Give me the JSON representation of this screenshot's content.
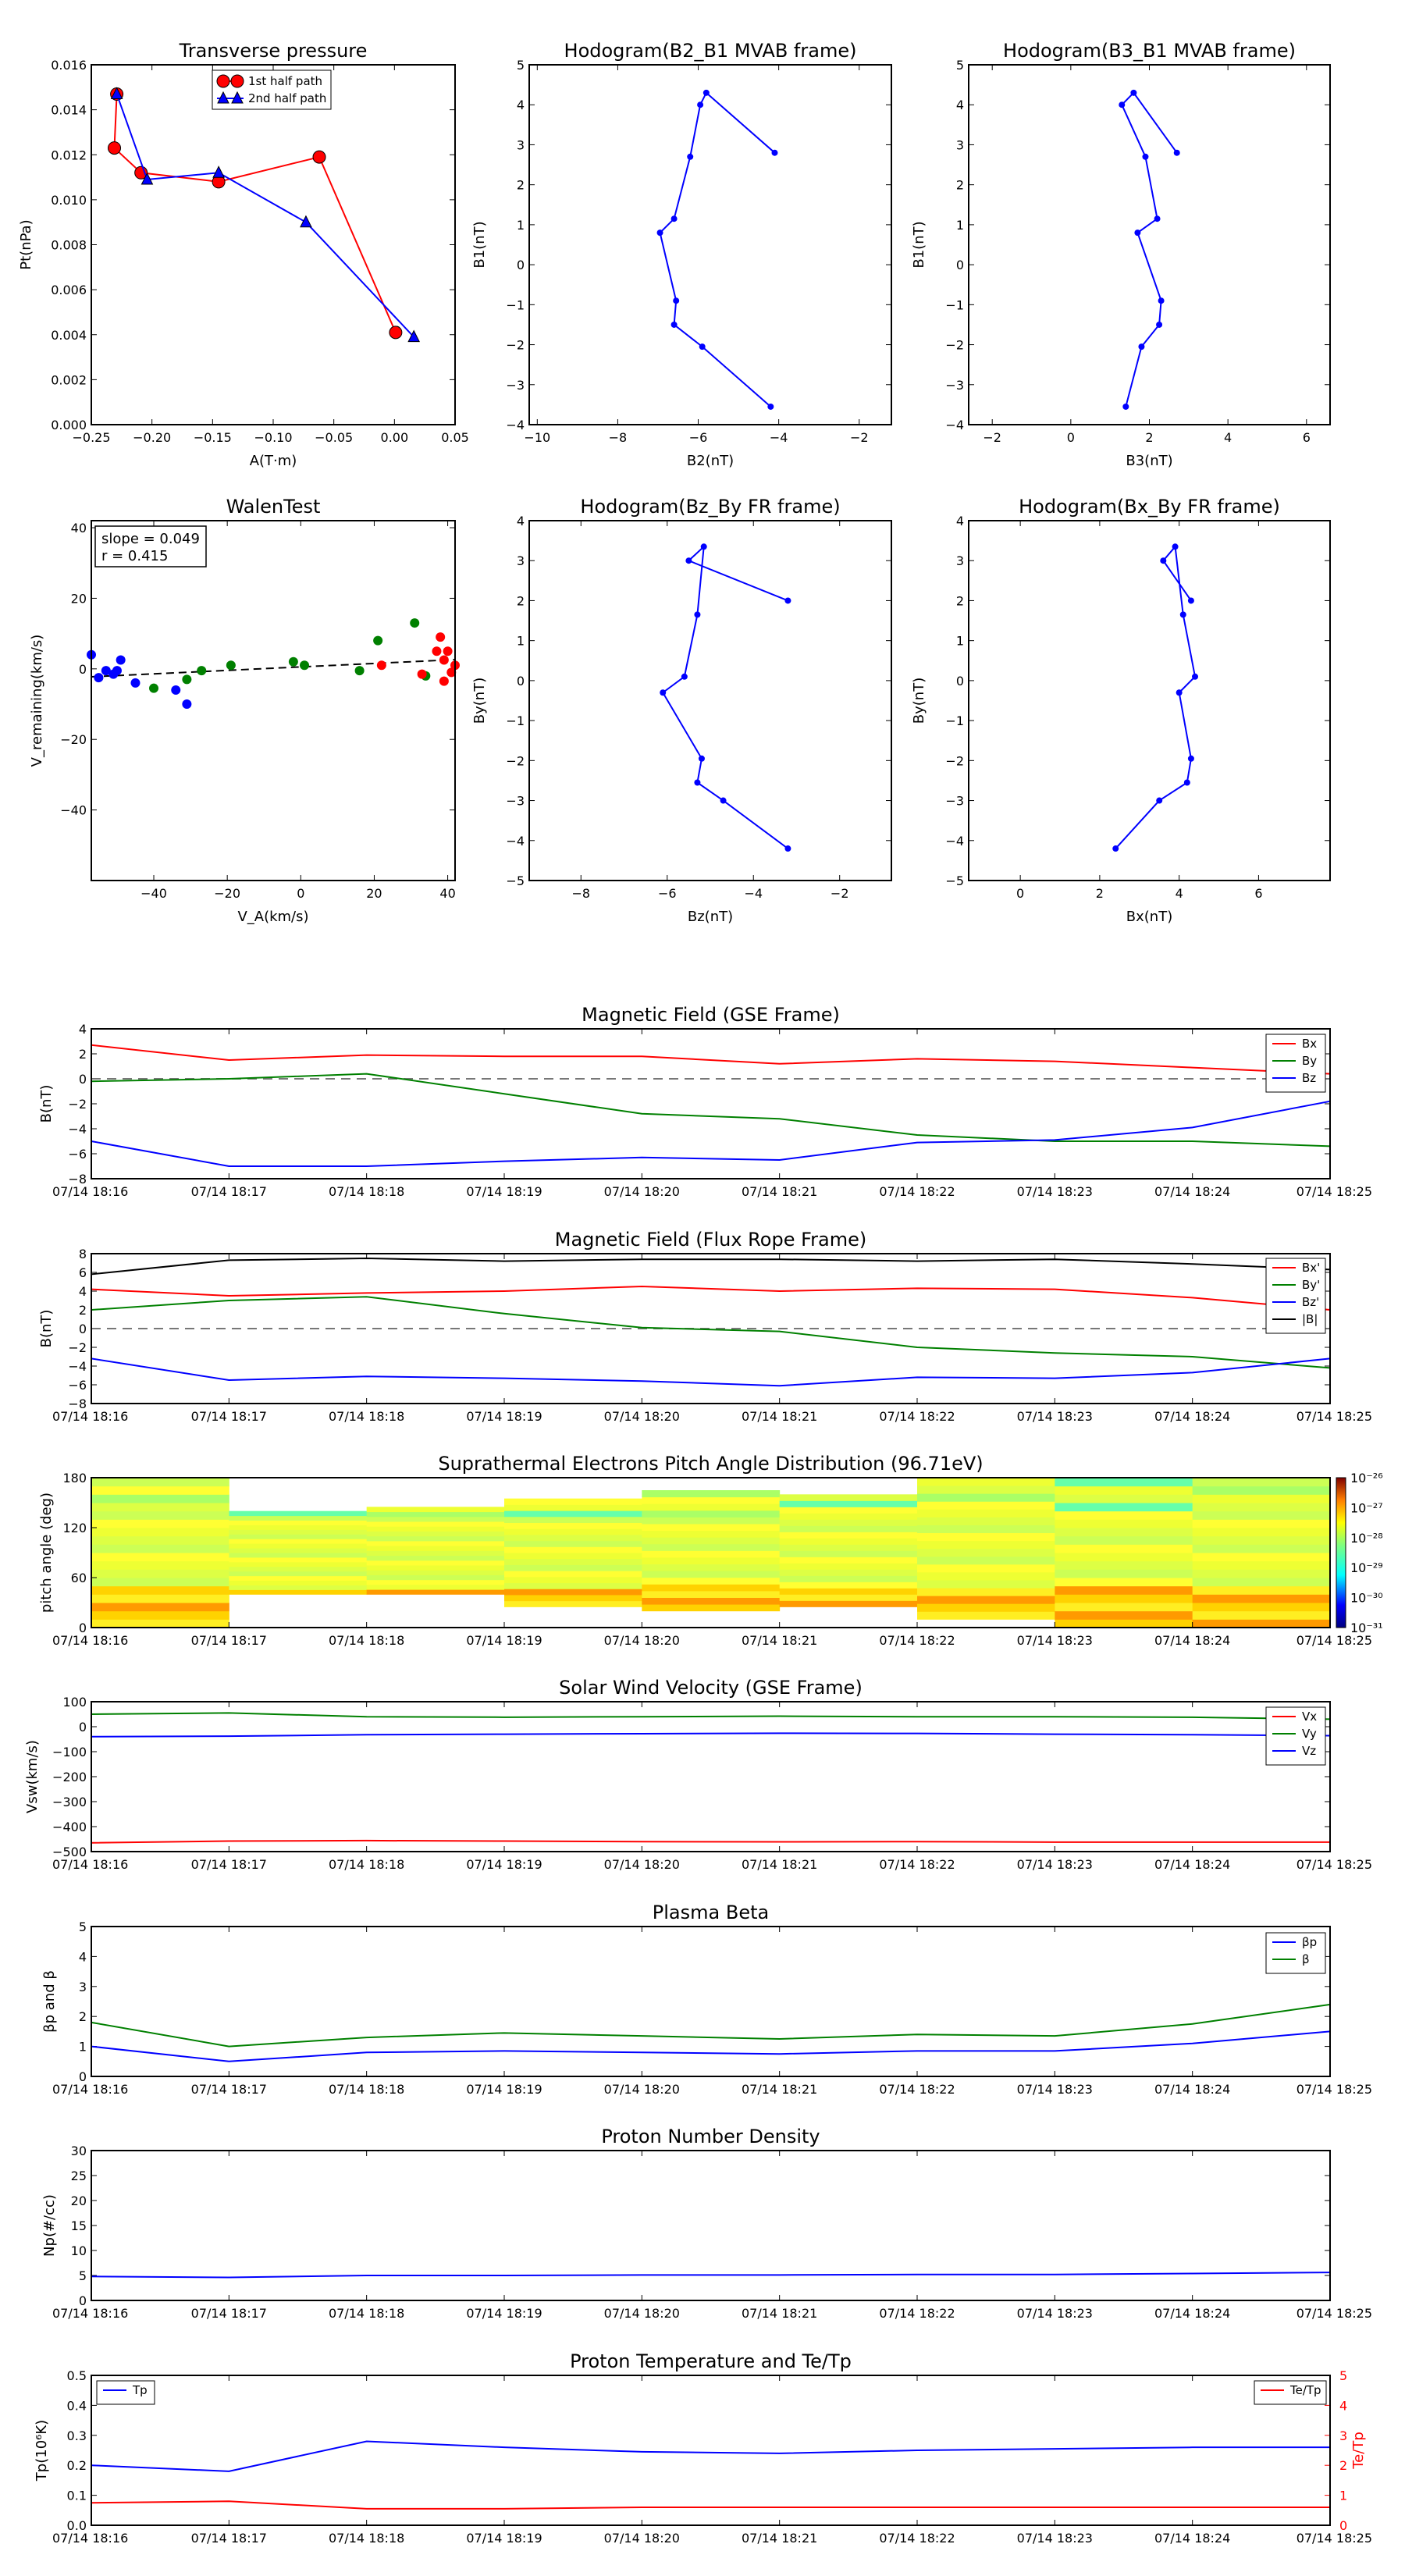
{
  "times": [
    "07/14 18:16",
    "07/14 18:17",
    "07/14 18:18",
    "07/14 18:19",
    "07/14 18:20",
    "07/14 18:21",
    "07/14 18:22",
    "07/14 18:23",
    "07/14 18:24",
    "07/14 18:25"
  ],
  "chart_data": [
    {
      "id": "transverse-pressure",
      "type": "line",
      "title": "Transverse pressure",
      "xlabel": "A(T·m)",
      "ylabel": "Pt(nPa)",
      "xlim": [
        -0.25,
        0.05
      ],
      "ylim": [
        0,
        0.016
      ],
      "xticks": [
        -0.25,
        -0.2,
        -0.15,
        -0.1,
        -0.05,
        0.0,
        0.05
      ],
      "xticklabels": [
        "−0.25",
        "−0.20",
        "−0.15",
        "−0.10",
        "−0.05",
        "0.00",
        "0.05"
      ],
      "yticks": [
        0,
        0.002,
        0.004,
        0.006,
        0.008,
        0.01,
        0.012,
        0.014,
        0.016
      ],
      "yticklabels": [
        "0.000",
        "0.002",
        "0.004",
        "0.006",
        "0.008",
        "0.010",
        "0.012",
        "0.014",
        "0.016"
      ],
      "legend_position": "top-center",
      "series": [
        {
          "name": "1st half path",
          "color": "#ff0000",
          "marker": "circle",
          "x": [
            -0.229,
            -0.231,
            -0.209,
            -0.145,
            -0.062,
            0.001
          ],
          "y": [
            0.0147,
            0.0123,
            0.0112,
            0.0108,
            0.0119,
            0.0041
          ]
        },
        {
          "name": "2nd half path",
          "color": "#0000ff",
          "marker": "triangle",
          "x": [
            -0.229,
            -0.204,
            -0.145,
            -0.073,
            0.016
          ],
          "y": [
            0.0147,
            0.0109,
            0.0112,
            0.009,
            0.0039
          ]
        }
      ]
    },
    {
      "id": "hodogram-b2-b1",
      "type": "line",
      "title": "Hodogram(B2_B1 MVAB frame)",
      "xlabel": "B2(nT)",
      "ylabel": "B1(nT)",
      "xlim": [
        -10.2,
        -1.2
      ],
      "ylim": [
        -4,
        5
      ],
      "xticks": [
        -10,
        -8,
        -6,
        -4,
        -2
      ],
      "xticklabels": [
        "−10",
        "−8",
        "−6",
        "−4",
        "−2"
      ],
      "yticks": [
        -4,
        -3,
        -2,
        -1,
        0,
        1,
        2,
        3,
        4,
        5
      ],
      "yticklabels": [
        "−4",
        "−3",
        "−2",
        "−1",
        "0",
        "1",
        "2",
        "3",
        "4",
        "5"
      ],
      "series": [
        {
          "color": "#0000ff",
          "x": [
            -4.1,
            -5.8,
            -5.95,
            -6.2,
            -6.6,
            -6.95,
            -6.55,
            -6.6,
            -5.9,
            -4.2
          ],
          "y": [
            2.8,
            4.3,
            4.0,
            2.7,
            1.15,
            0.8,
            -0.9,
            -1.5,
            -2.05,
            -3.55
          ]
        }
      ]
    },
    {
      "id": "hodogram-b3-b1",
      "type": "line",
      "title": "Hodogram(B3_B1 MVAB frame)",
      "xlabel": "B3(nT)",
      "ylabel": "B1(nT)",
      "xlim": [
        -2.6,
        6.6
      ],
      "ylim": [
        -4,
        5
      ],
      "xticks": [
        -2,
        0,
        2,
        4,
        6
      ],
      "xticklabels": [
        "−2",
        "0",
        "2",
        "4",
        "6"
      ],
      "yticks": [
        -4,
        -3,
        -2,
        -1,
        0,
        1,
        2,
        3,
        4,
        5
      ],
      "yticklabels": [
        "−4",
        "−3",
        "−2",
        "−1",
        "0",
        "1",
        "2",
        "3",
        "4",
        "5"
      ],
      "series": [
        {
          "color": "#0000ff",
          "x": [
            2.7,
            1.6,
            1.3,
            1.9,
            2.2,
            1.7,
            2.3,
            2.25,
            1.8,
            1.4
          ],
          "y": [
            2.8,
            4.3,
            4.0,
            2.7,
            1.15,
            0.8,
            -0.9,
            -1.5,
            -2.05,
            -3.55
          ]
        }
      ]
    },
    {
      "id": "walen-test",
      "type": "scatter",
      "title": "WalenTest",
      "xlabel": "V_A(km/s)",
      "ylabel": "V_remaining(km/s)",
      "annotation": [
        "slope = 0.049",
        "r = 0.415"
      ],
      "xlim": [
        -57,
        42
      ],
      "ylim": [
        -60,
        42
      ],
      "xticks": [
        -40,
        -20,
        0,
        20,
        40
      ],
      "xticklabels": [
        "−40",
        "−20",
        "0",
        "20",
        "40"
      ],
      "yticks": [
        -40,
        -20,
        0,
        20,
        40
      ],
      "yticklabels": [
        "−40",
        "−20",
        "0",
        "20",
        "40"
      ],
      "fit": {
        "slope": 0.049,
        "intercept": 0.55
      },
      "series": [
        {
          "color": "#0000ff",
          "x": [
            -57,
            -55,
            -53,
            -51,
            -50,
            -49,
            -45,
            -34,
            -31
          ],
          "y": [
            4,
            -2.5,
            -0.5,
            -1.5,
            -0.5,
            2.5,
            -4,
            -6,
            -10
          ]
        },
        {
          "color": "#008000",
          "x": [
            -40,
            -31,
            -27,
            -19,
            -2,
            1,
            16,
            21,
            31,
            34
          ],
          "y": [
            -5.5,
            -3,
            -0.5,
            1,
            2,
            1,
            -0.5,
            8,
            13,
            -2
          ]
        },
        {
          "color": "#ff0000",
          "x": [
            22,
            33,
            37,
            38,
            39,
            39,
            40,
            41,
            42
          ],
          "y": [
            1,
            -1.5,
            5,
            9,
            2.5,
            -3.5,
            5,
            -1,
            1
          ]
        }
      ]
    },
    {
      "id": "hodogram-bz-by",
      "type": "line",
      "title": "Hodogram(Bz_By FR frame)",
      "xlabel": "Bz(nT)",
      "ylabel": "By(nT)",
      "xlim": [
        -9.2,
        -0.8
      ],
      "ylim": [
        -5,
        4
      ],
      "xticks": [
        -8,
        -6,
        -4,
        -2
      ],
      "xticklabels": [
        "−8",
        "−6",
        "−4",
        "−2"
      ],
      "yticks": [
        -5,
        -4,
        -3,
        -2,
        -1,
        0,
        1,
        2,
        3,
        4
      ],
      "yticklabels": [
        "−5",
        "−4",
        "−3",
        "−2",
        "−1",
        "0",
        "1",
        "2",
        "3",
        "4"
      ],
      "series": [
        {
          "color": "#0000ff",
          "x": [
            -3.2,
            -5.5,
            -5.15,
            -5.3,
            -5.6,
            -6.1,
            -5.2,
            -5.3,
            -4.7,
            -3.2
          ],
          "y": [
            2.0,
            3.0,
            3.35,
            1.65,
            0.1,
            -0.3,
            -1.95,
            -2.55,
            -3.0,
            -4.2
          ]
        }
      ]
    },
    {
      "id": "hodogram-bx-by",
      "type": "line",
      "title": "Hodogram(Bx_By FR frame)",
      "xlabel": "Bx(nT)",
      "ylabel": "By(nT)",
      "xlim": [
        -1.3,
        7.8
      ],
      "ylim": [
        -5,
        4
      ],
      "xticks": [
        0,
        2,
        4,
        6
      ],
      "xticklabels": [
        "0",
        "2",
        "4",
        "6"
      ],
      "yticks": [
        -5,
        -4,
        -3,
        -2,
        -1,
        0,
        1,
        2,
        3,
        4
      ],
      "yticklabels": [
        "−5",
        "−4",
        "−3",
        "−2",
        "−1",
        "0",
        "1",
        "2",
        "3",
        "4"
      ],
      "series": [
        {
          "color": "#0000ff",
          "x": [
            4.3,
            3.6,
            3.9,
            4.1,
            4.4,
            4.0,
            4.3,
            4.2,
            3.5,
            2.4
          ],
          "y": [
            2.0,
            3.0,
            3.35,
            1.65,
            0.1,
            -0.3,
            -1.95,
            -2.55,
            -3.0,
            -4.2
          ]
        }
      ]
    },
    {
      "id": "mag-gse",
      "type": "line",
      "title": "Magnetic Field (GSE Frame)",
      "ylabel": "B(nT)",
      "ylim": [
        -8,
        4
      ],
      "yticks": [
        -8,
        -6,
        -4,
        -2,
        0,
        2,
        4
      ],
      "yticklabels": [
        "−8",
        "−6",
        "−4",
        "−2",
        "0",
        "2",
        "4"
      ],
      "legend_position": "right",
      "series": [
        {
          "name": "Bx",
          "color": "#ff0000",
          "values": [
            2.7,
            1.5,
            1.9,
            1.8,
            1.8,
            1.2,
            1.6,
            1.4,
            0.9,
            0.4
          ]
        },
        {
          "name": "By",
          "color": "#008000",
          "values": [
            -0.2,
            0.0,
            0.4,
            -1.2,
            -2.8,
            -3.2,
            -4.5,
            -5.0,
            -5.0,
            -5.4
          ]
        },
        {
          "name": "Bz",
          "color": "#0000ff",
          "values": [
            -5.0,
            -7.0,
            -7.0,
            -6.6,
            -6.3,
            -6.5,
            -5.1,
            -4.9,
            -3.9,
            -1.8
          ]
        }
      ]
    },
    {
      "id": "mag-fr",
      "type": "line",
      "title": "Magnetic Field (Flux Rope Frame)",
      "ylabel": "B(nT)",
      "ylim": [
        -8,
        8
      ],
      "yticks": [
        -8,
        -6,
        -4,
        -2,
        0,
        2,
        4,
        6,
        8
      ],
      "yticklabels": [
        "−8",
        "−6",
        "−4",
        "−2",
        "0",
        "2",
        "4",
        "6",
        "8"
      ],
      "legend_position": "right",
      "series": [
        {
          "name": "Bx'",
          "color": "#ff0000",
          "values": [
            4.2,
            3.5,
            3.8,
            4.0,
            4.5,
            4.0,
            4.3,
            4.2,
            3.3,
            2.0
          ]
        },
        {
          "name": "By'",
          "color": "#008000",
          "values": [
            2.0,
            3.0,
            3.4,
            1.6,
            0.1,
            -0.3,
            -2.0,
            -2.6,
            -3.0,
            -4.2
          ]
        },
        {
          "name": "Bz'",
          "color": "#0000ff",
          "values": [
            -3.2,
            -5.5,
            -5.1,
            -5.3,
            -5.6,
            -6.1,
            -5.2,
            -5.3,
            -4.7,
            -3.2
          ]
        },
        {
          "name": "|B|",
          "color": "#000000",
          "values": [
            5.8,
            7.3,
            7.5,
            7.2,
            7.4,
            7.4,
            7.2,
            7.4,
            6.9,
            6.3
          ]
        }
      ]
    },
    {
      "id": "pitch-angle",
      "type": "heatmap",
      "title": "Suprathermal Electrons Pitch Angle Distribution (96.71eV)",
      "ylabel": "pitch angle (deg)",
      "ylim": [
        0,
        180
      ],
      "yticks": [
        0,
        60,
        120,
        180
      ],
      "yticklabels": [
        "0",
        "60",
        "120",
        "180"
      ],
      "colorbar_labels": [
        "10⁻²⁶",
        "10⁻²⁷",
        "10⁻²⁸",
        "10⁻²⁹",
        "10⁻³⁰",
        "10⁻³¹"
      ],
      "columns": [
        {
          "coverage": [
            0,
            180
          ]
        },
        {
          "coverage": [
            40,
            140
          ]
        },
        {
          "coverage": [
            40,
            145
          ]
        },
        {
          "coverage": [
            25,
            155
          ]
        },
        {
          "coverage": [
            20,
            165
          ]
        },
        {
          "coverage": [
            25,
            160
          ]
        },
        {
          "coverage": [
            10,
            180
          ]
        },
        {
          "coverage": [
            0,
            180
          ]
        },
        {
          "coverage": [
            0,
            180
          ]
        }
      ]
    },
    {
      "id": "sw-velocity",
      "type": "line",
      "title": "Solar Wind Velocity (GSE Frame)",
      "ylabel": "Vsw(km/s)",
      "ylim": [
        -500,
        100
      ],
      "yticks": [
        -500,
        -400,
        -300,
        -200,
        -100,
        0,
        100
      ],
      "yticklabels": [
        "−500",
        "−400",
        "−300",
        "−200",
        "−100",
        "0",
        "100"
      ],
      "legend_position": "right",
      "series": [
        {
          "name": "Vx",
          "color": "#ff0000",
          "values": [
            -465,
            -458,
            -456,
            -458,
            -460,
            -461,
            -460,
            -462,
            -462,
            -462
          ]
        },
        {
          "name": "Vy",
          "color": "#008000",
          "values": [
            50,
            55,
            40,
            38,
            40,
            42,
            40,
            40,
            38,
            30
          ]
        },
        {
          "name": "Vz",
          "color": "#0000ff",
          "values": [
            -40,
            -38,
            -32,
            -30,
            -28,
            -26,
            -27,
            -30,
            -32,
            -36
          ]
        }
      ]
    },
    {
      "id": "plasma-beta",
      "type": "line",
      "title": "Plasma Beta",
      "ylabel": "βp and β",
      "ylim": [
        0,
        5
      ],
      "yticks": [
        0,
        1,
        2,
        3,
        4,
        5
      ],
      "yticklabels": [
        "0",
        "1",
        "2",
        "3",
        "4",
        "5"
      ],
      "legend_position": "right",
      "series": [
        {
          "name": "βp",
          "color": "#0000ff",
          "values": [
            1.0,
            0.5,
            0.8,
            0.85,
            0.8,
            0.75,
            0.85,
            0.85,
            1.1,
            1.5
          ]
        },
        {
          "name": "β",
          "color": "#008000",
          "values": [
            1.8,
            1.0,
            1.3,
            1.45,
            1.35,
            1.25,
            1.4,
            1.35,
            1.75,
            2.4
          ]
        }
      ]
    },
    {
      "id": "proton-density",
      "type": "line",
      "title": "Proton Number Density",
      "ylabel": "Np(#/cc)",
      "ylim": [
        0,
        30
      ],
      "yticks": [
        0,
        5,
        10,
        15,
        20,
        25,
        30
      ],
      "yticklabels": [
        "0",
        "5",
        "10",
        "15",
        "20",
        "25",
        "30"
      ],
      "series": [
        {
          "color": "#0000ff",
          "values": [
            4.8,
            4.6,
            5.0,
            5.0,
            5.1,
            5.1,
            5.2,
            5.2,
            5.4,
            5.6
          ]
        }
      ]
    },
    {
      "id": "proton-temp",
      "type": "line",
      "title": "Proton Temperature and Te/Tp",
      "ylabel": "Tp(10⁶K)",
      "y2label": "Te/Tp",
      "ylim": [
        0,
        0.5
      ],
      "yticks": [
        0,
        0.1,
        0.2,
        0.3,
        0.4,
        0.5
      ],
      "yticklabels": [
        "0.0",
        "0.1",
        "0.2",
        "0.3",
        "0.4",
        "0.5"
      ],
      "y2lim": [
        0,
        5
      ],
      "y2ticks": [
        0,
        1,
        2,
        3,
        4,
        5
      ],
      "y2ticklabels": [
        "0",
        "1",
        "2",
        "3",
        "4",
        "5"
      ],
      "legend_position": "top-left / top-right",
      "series": [
        {
          "name": "Tp",
          "color": "#0000ff",
          "axis": "left",
          "values": [
            0.2,
            0.18,
            0.28,
            0.26,
            0.245,
            0.24,
            0.25,
            0.255,
            0.26,
            0.26
          ]
        },
        {
          "name": "Te/Tp",
          "color": "#ff0000",
          "axis": "right",
          "values": [
            0.75,
            0.8,
            0.55,
            0.55,
            0.6,
            0.6,
            0.6,
            0.6,
            0.6,
            0.6
          ]
        }
      ]
    }
  ]
}
